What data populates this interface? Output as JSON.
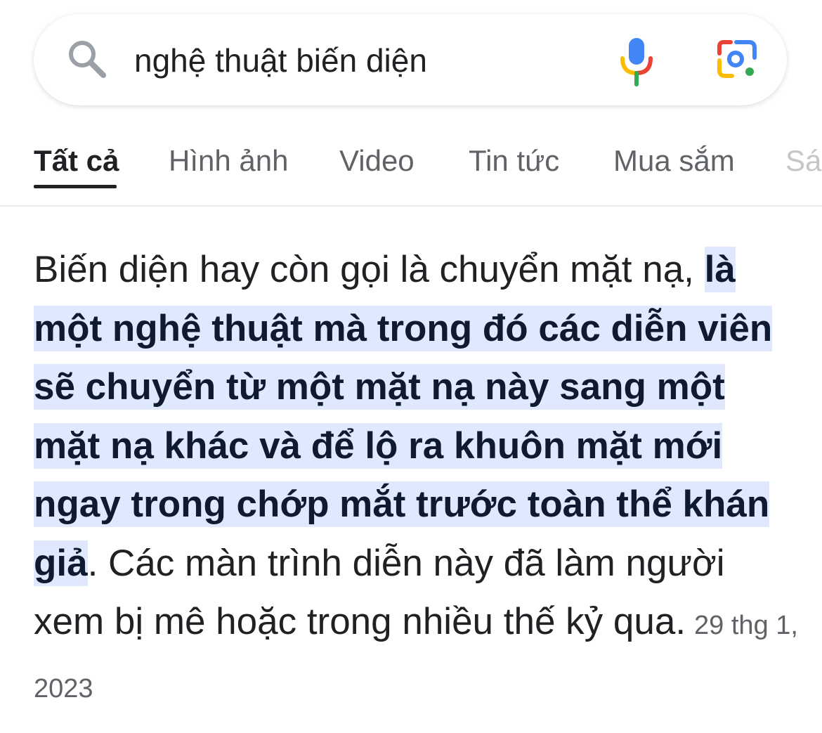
{
  "search": {
    "query": "nghệ thuật biến diện",
    "icons": {
      "left": "search-icon",
      "voice": "mic-icon",
      "image": "google-lens-icon"
    }
  },
  "tabs": [
    {
      "label": "Tất cả",
      "active": true
    },
    {
      "label": "Hình ảnh",
      "active": false
    },
    {
      "label": "Video",
      "active": false
    },
    {
      "label": "Tin tức",
      "active": false
    },
    {
      "label": "Mua sắm",
      "active": false
    },
    {
      "label": "Sá",
      "active": false
    }
  ],
  "featured_snippet": {
    "text_before": "Biến diện hay còn gọi là chuyển mặt nạ, ",
    "highlight": "là một nghệ thuật mà trong đó các diễn viên sẽ chuyển từ một mặt nạ này sang một mặt nạ khác và để lộ ra khuôn mặt mới ngay trong chớp mắt trước toàn thể khán giả",
    "text_after": ". Các màn trình diễn này đã làm người xem bị mê hoặc trong nhiều thế kỷ qua.",
    "date": "29 thg 1, 2023"
  },
  "colors": {
    "highlight_bg": "#e0e8fd",
    "text": "#202124",
    "muted": "#5f6368",
    "google_blue": "#4285f4",
    "google_red": "#ea4335",
    "google_yellow": "#fbbc04",
    "google_green": "#34a853"
  }
}
